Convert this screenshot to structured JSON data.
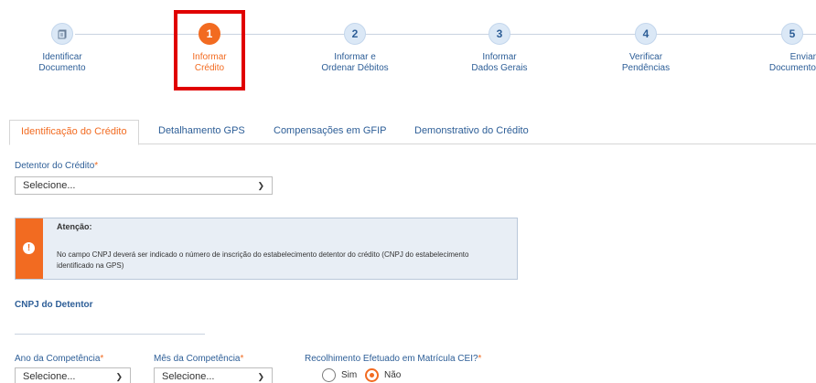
{
  "stepper": {
    "steps": [
      {
        "num": "",
        "icon": "document-icon",
        "line1": "Identificar",
        "line2": "Documento"
      },
      {
        "num": "1",
        "line1": "Informar",
        "line2": "Crédito"
      },
      {
        "num": "2",
        "line1": "Informar e",
        "line2": "Ordenar Débitos"
      },
      {
        "num": "3",
        "line1": "Informar",
        "line2": "Dados Gerais"
      },
      {
        "num": "4",
        "line1": "Verificar",
        "line2": "Pendências"
      },
      {
        "num": "5",
        "line1": "Enviar",
        "line2": "Documento"
      }
    ]
  },
  "tabs": [
    "Identificação do Crédito",
    "Detalhamento GPS",
    "Compensações em GFIP",
    "Demonstrativo do Crédito"
  ],
  "detentor": {
    "label": "Detentor do Crédito",
    "required": "*",
    "value": "Selecione..."
  },
  "alert": {
    "title": "Atenção:",
    "message": "No campo CNPJ deverá ser indicado o número de inscrição do estabelecimento detentor do crédito (CNPJ do estabelecimento identificado na GPS)"
  },
  "cnpj": {
    "label": "CNPJ do Detentor"
  },
  "ano": {
    "label": "Ano da Competência",
    "required": "*",
    "value": "Selecione..."
  },
  "mes": {
    "label": "Mês da Competência",
    "required": "*",
    "value": "Selecione..."
  },
  "recolhimento": {
    "label": "Recolhimento Efetuado em Matrícula CEI?",
    "required": "*",
    "opt_sim": "Sim",
    "opt_nao": "Não",
    "selected": "Não"
  },
  "colors": {
    "accent": "#f26b21",
    "link": "#2d5e97",
    "highlight": "#e00000"
  }
}
